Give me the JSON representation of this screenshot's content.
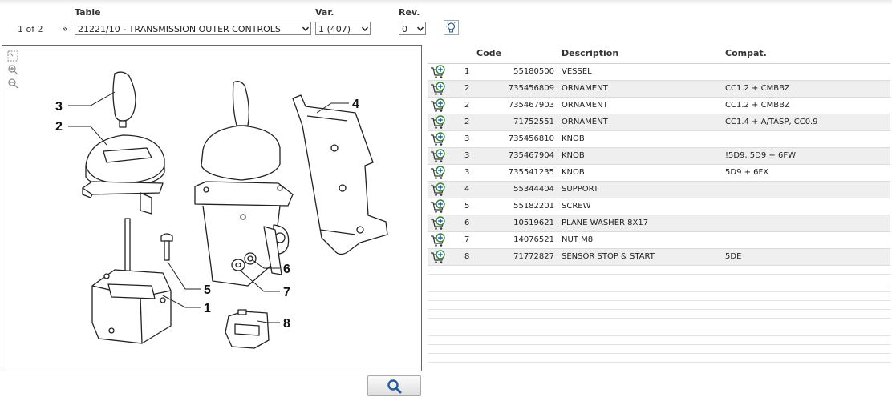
{
  "header": {
    "table_label": "Table",
    "var_label": "Var.",
    "rev_label": "Rev.",
    "page_info": "1 of 2",
    "nav_glyph": "»",
    "table_value": "21221/10 - TRANSMISSION OUTER CONTROLS",
    "var_value": "1 (407)",
    "rev_value": "0"
  },
  "icons": [
    "fit-icon",
    "zoom-in-icon",
    "zoom-out-icon",
    "lightbulb-icon",
    "cart-add-icon",
    "search-icon"
  ],
  "colors": {
    "accent": "#1e5aa8",
    "row_alt": "#efefef",
    "cart_green": "#2f8a3a"
  },
  "diagram": {
    "callouts": [
      "1",
      "2",
      "3",
      "4",
      "5",
      "6",
      "7",
      "8"
    ]
  },
  "columns": {
    "code": "Code",
    "description": "Description",
    "compat": "Compat."
  },
  "parts": [
    {
      "qty": "1",
      "code": "55180500",
      "desc": "VESSEL",
      "compat": ""
    },
    {
      "qty": "2",
      "code": "735456809",
      "desc": "ORNAMENT",
      "compat": "CC1.2 + CMBBZ"
    },
    {
      "qty": "2",
      "code": "735467903",
      "desc": "ORNAMENT",
      "compat": "CC1.2 + CMBBZ"
    },
    {
      "qty": "2",
      "code": "71752551",
      "desc": "ORNAMENT",
      "compat": "CC1.4 + A/TASP, CC0.9"
    },
    {
      "qty": "3",
      "code": "735456810",
      "desc": "KNOB",
      "compat": ""
    },
    {
      "qty": "3",
      "code": "735467904",
      "desc": "KNOB",
      "compat": "!5D9, 5D9 + 6FW"
    },
    {
      "qty": "3",
      "code": "735541235",
      "desc": "KNOB",
      "compat": "5D9 + 6FX"
    },
    {
      "qty": "4",
      "code": "55344404",
      "desc": "SUPPORT",
      "compat": ""
    },
    {
      "qty": "5",
      "code": "55182201",
      "desc": "SCREW",
      "compat": ""
    },
    {
      "qty": "6",
      "code": "10519621",
      "desc": "PLANE WASHER 8X17",
      "compat": ""
    },
    {
      "qty": "7",
      "code": "14076521",
      "desc": "NUT M8",
      "compat": ""
    },
    {
      "qty": "8",
      "code": "71772827",
      "desc": "SENSOR STOP & START",
      "compat": "5DE"
    }
  ]
}
